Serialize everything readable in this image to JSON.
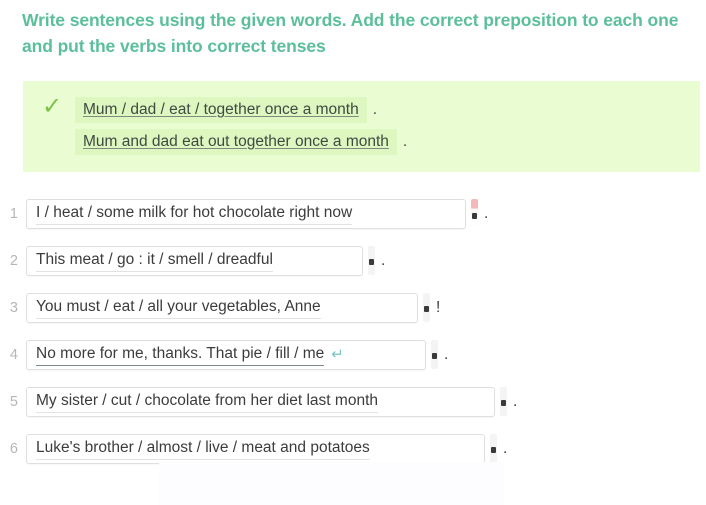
{
  "exercise": {
    "title": "Write sentences using the given words. Add the correct preposition to each one and put the verbs into correct tenses",
    "title_color": "#5cbf9b",
    "example": {
      "status_icon": "check-icon",
      "status_color": "#79c347",
      "background_color": "#eafdd2",
      "highlight_color": "#def6c0",
      "prompt_text": "Mum / dad / eat / together once a month",
      "prompt_punct": ".",
      "answer_text": "Mum and dad eat out together once a month",
      "answer_punct": "."
    },
    "items": [
      {
        "number": "1",
        "value": "I / heat / some milk for hot chocolate right now",
        "punct": ".",
        "field_width": 440,
        "scroll_indicator": "pink",
        "enter_icon": false,
        "active": false
      },
      {
        "number": "2",
        "value": "This meat / go : it / smell / dreadful",
        "punct": ".",
        "field_width": 337,
        "scroll_indicator": "gray",
        "enter_icon": false,
        "active": false
      },
      {
        "number": "3",
        "value": "You must / eat / all your vegetables, Anne",
        "punct": "!",
        "field_width": 392,
        "scroll_indicator": "gray",
        "enter_icon": false,
        "active": false
      },
      {
        "number": "4",
        "value": "No more for me, thanks. That pie / fill / me",
        "punct": ".",
        "field_width": 400,
        "scroll_indicator": "gray",
        "enter_icon": true,
        "enter_icon_name": "enter-return-icon",
        "enter_icon_glyph": "↵",
        "active": true
      },
      {
        "number": "5",
        "value": "My sister / cut / chocolate from her diet last month",
        "punct": ".",
        "field_width": 469,
        "scroll_indicator": "gray",
        "enter_icon": false,
        "active": false
      },
      {
        "number": "6",
        "value": "Luke's brother / almost / live / meat and potatoes",
        "punct": ".",
        "field_width": 459,
        "scroll_indicator": "gray",
        "enter_icon": false,
        "active": false
      }
    ]
  }
}
